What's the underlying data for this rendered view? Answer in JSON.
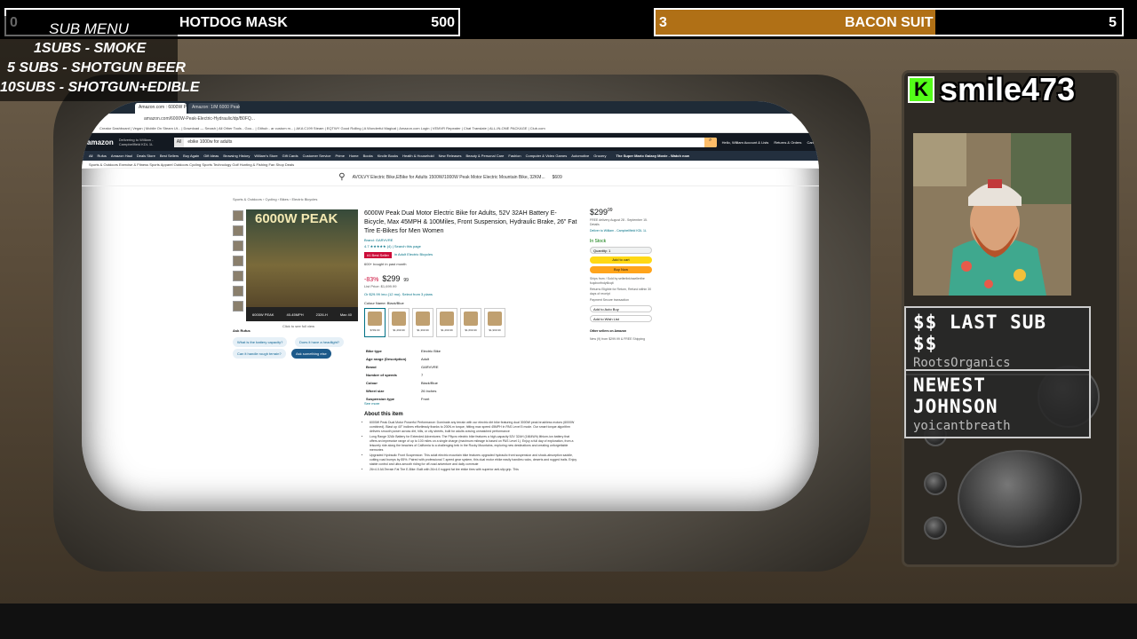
{
  "goals": {
    "left": {
      "count": "0",
      "label": "HOTDOG MASK",
      "target": "500",
      "progress": 0.0,
      "fill_color": "#000000"
    },
    "right": {
      "count": "3",
      "label": "BACON SUIT",
      "target": "5",
      "progress": 0.6,
      "fill_color": "#b07016"
    }
  },
  "submenu": {
    "title": "SUB MENU",
    "items": [
      "1SUBS   - SMOKE",
      "5 SUBS  - SHOTGUN BEER",
      "10SUBS - SHOTGUN+EDIBLE"
    ]
  },
  "streamer": {
    "platform_icon": "kick-logo-icon",
    "platform_letter": "K",
    "name": "smile473",
    "brand_color": "#53fc18"
  },
  "alerts": {
    "last_sub": {
      "heading": "$$ LAST SUB $$",
      "value": "RootsOrganics"
    },
    "newest": {
      "heading": "NEWEST JOHNSON",
      "value": "yoicantbreath"
    }
  },
  "browser": {
    "tabs": [
      "Amazon.com : 6000W Peak Dual",
      "Amazon: 1/M 6000 Peak Dual Bike"
    ],
    "url": "amazon.com/6000W-Peak-Electric-Hydraulic/dp/B0FQ...",
    "bookmarks": "Creator Dashboard | Vegan | Mobile On Steam Ut... | Download — Smash | All Other Tools - Goo... | Github - ar custom m... | AKA C199 Steam | EQTWY Good Rolling | A Wonderful Magical | Amazon.com Login | VEMVR Repeater | Chat Translate | ALL-IN-ONE PACKAGE | Club.com",
    "amazon": {
      "logo": "amazon",
      "deliver_to": "Delivering to William - Campbellfield KDL 1L",
      "search_scope": "All",
      "search_value": "ebike 1000w for adults",
      "account": "Hello, William  Account & Lists",
      "orders": "Returns & Orders",
      "cart": "Cart",
      "nav": [
        "All",
        "Rufus",
        "Amazon Haul",
        "Deals Store",
        "Best Sellers",
        "Buy Again",
        "Gift Ideas",
        "Browsing History",
        "William's Store",
        "Gift Cards",
        "Customer Service",
        "Prime",
        "Home",
        "Books",
        "Kindle Books",
        "Health & Household",
        "New Releases",
        "Beauty & Personal Care",
        "Fashion",
        "Computer & Video Games",
        "Automotive",
        "Grocery"
      ],
      "nav_promo": "The Super Mario Galaxy Movie - Watch now",
      "subnav": "Sports & Outdoors   Exercise & Fitness   Sports Apparel   Outdoors   Cycling   Sports Technology   Golf   Hunting & Fishing   Fan Shop   Deals",
      "ad": {
        "text": "AVOLVY Electric Bike,EBike for Adults 1500W/1000W Peak Motor Electric Mountain Bike, 32KM...",
        "price": "$609"
      },
      "breadcrumb": "Sports & Outdoors › Cycling › Bikes › Electric Bicycles",
      "image_badge": "6000W PEAK",
      "image_specs": [
        "6000W PEAK",
        "40-45MPH",
        "2326-H",
        "Max 40"
      ],
      "click_full": "Click to see full view",
      "rufus": {
        "label": "Ask Rufus",
        "q1": "What is the battery capacity?",
        "q2": "Does it have a headlight?",
        "q3": "Can it handle rough terrain?",
        "q4": "Ask something else"
      },
      "title": "6000W Peak Dual Motor Electric Bike for Adults, 52V 32AH Battery E-Bicycle, Max 45MPH & 100Miles, Front Suspension, Hydraulic Brake, 26\" Fat Tire E-Bikes for Men Women",
      "brand": "Brand: GARVVRE",
      "rating": "4.7 ★★★★★ (4)  |  Search this page",
      "deal_badge": "#1 Best Seller",
      "deal_badge_text": "in Adult Electric Bicycles",
      "bought": "600+ bought in past month",
      "discount": "-83%",
      "price": "$299",
      "price_cents": "99",
      "list_price": "List Price: $1,699.99",
      "or_price": "Or $29.99 /mo (12 mo). Select from 3 plans",
      "colour_label": "Colour Name: Black/Blue",
      "variants": [
        "$799.00",
        "$1,299.99",
        "$1,399.99",
        "$1,299.99",
        "$1,699.99",
        "$1,999.99"
      ],
      "specs": [
        [
          "Bike type",
          "Electric Bike"
        ],
        [
          "Age range (Description)",
          "Adult"
        ],
        [
          "Brand",
          "GARVVRE"
        ],
        [
          "Number of speeds",
          "7"
        ],
        [
          "Colour",
          "Black/Blue"
        ],
        [
          "Wheel size",
          "26 Inches"
        ],
        [
          "Suspension type",
          "Front"
        ]
      ],
      "see_more": "See more",
      "about_heading": "About this item",
      "about_items": [
        "6000W Peak Dual Motor Powerful Performance: Dominate any terrain with our electric dirt bike featuring dual 3000W peak brushless motors (6000W combined). Blast up 40° inclines effortlessly thanks to 200N.m torque, hitting max speed 45MPH in PAS Level 5 mode. Our smart torque algorithm delivers smooth power across dirt, hills, or city streets, built for adults craving unmatched performance",
        "Long Range 32Ah Battery for Extended Adventures: The Fflycro electric bike features a high-capacity 52V 32AH (1664Wh) lithium-ion battery that offers an impressive range of up to 100 miles on a single charge (maximum mileage is based on PAS Level 1). Enjoy a full day of exploration, from a leisurely ride along the beaches of California to a challenging trek in the Rocky Mountains, exploring new destinations and creating unforgettable memories",
        "Upgraded Hydraulic Front Suspension: This adult electric mountain bike features upgraded hydraulic front suspension and shock-absorption saddle, cutting road bumps by 85%. Paired with professional 7-speed gear system, this dual motor ebike easily handles rocks, deserts and rugged trails. Enjoy stable control and ultra-smooth riding for off-road adventure and daily commute",
        "26×4.0 All-Terrain Fat Tire E-Bike: Built with 26×4.0 rugged fat tire ebike tires with superior anti-slip grip. This"
      ],
      "buybox": {
        "price": "$299",
        "cents": "99",
        "delivery": "FREE delivery August 28 - September 15. Details",
        "deliver_to": "Deliver to William - Campbellfield KDL 1L",
        "stock": "In Stock",
        "qty": "Quantity: 1",
        "add_cart": "Add to cart",
        "buy_now": "Buy Now",
        "ships_from": "Ships from / Sold by  sellerlink/ssellerthe fcqcbcnfndytlicqit",
        "returns": "Returns  Eligible for Return, Refund within 30 days of receipt",
        "payment": "Payment  Secure transaction",
        "add_autobuy": "Add to Auto Buy",
        "add_wishlist": "Add to Wish List",
        "other_sellers": "Other sellers on Amazon",
        "new_offer": "New (9) from $299.99 & FREE Shipping"
      }
    }
  }
}
